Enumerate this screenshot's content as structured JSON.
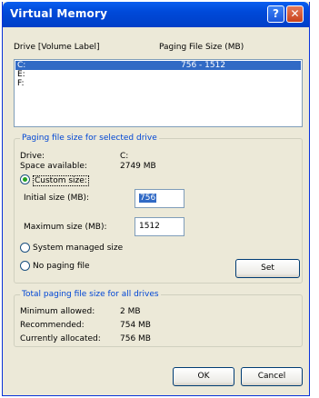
{
  "window": {
    "title": "Virtual Memory",
    "help_glyph": "?",
    "close_glyph": "✕"
  },
  "drives": {
    "header_drive": "Drive  [Volume Label]",
    "header_paging": "Paging File Size (MB)",
    "items": [
      {
        "drive": "C:",
        "size": "756 - 1512",
        "selected": true
      },
      {
        "drive": "E:",
        "size": ""
      },
      {
        "drive": "F:",
        "size": ""
      }
    ]
  },
  "selected_group": {
    "title": "Paging file size for selected drive",
    "drive_label": "Drive:",
    "drive_value": "C:",
    "space_label": "Space available:",
    "space_value": "2749 MB",
    "custom_label": "Custom size:",
    "initial_label": "Initial size (MB):",
    "initial_value": "756",
    "maximum_label": "Maximum size (MB):",
    "maximum_value": "1512",
    "system_label": "System managed size",
    "nopaging_label": "No paging file",
    "set_label": "Set",
    "selected_option": "custom"
  },
  "total_group": {
    "title": "Total paging file size for all drives",
    "minimum_label": "Minimum allowed:",
    "minimum_value": "2 MB",
    "recommended_label": "Recommended:",
    "recommended_value": "754 MB",
    "allocated_label": "Currently allocated:",
    "allocated_value": "756 MB"
  },
  "buttons": {
    "ok": "OK",
    "cancel": "Cancel"
  }
}
